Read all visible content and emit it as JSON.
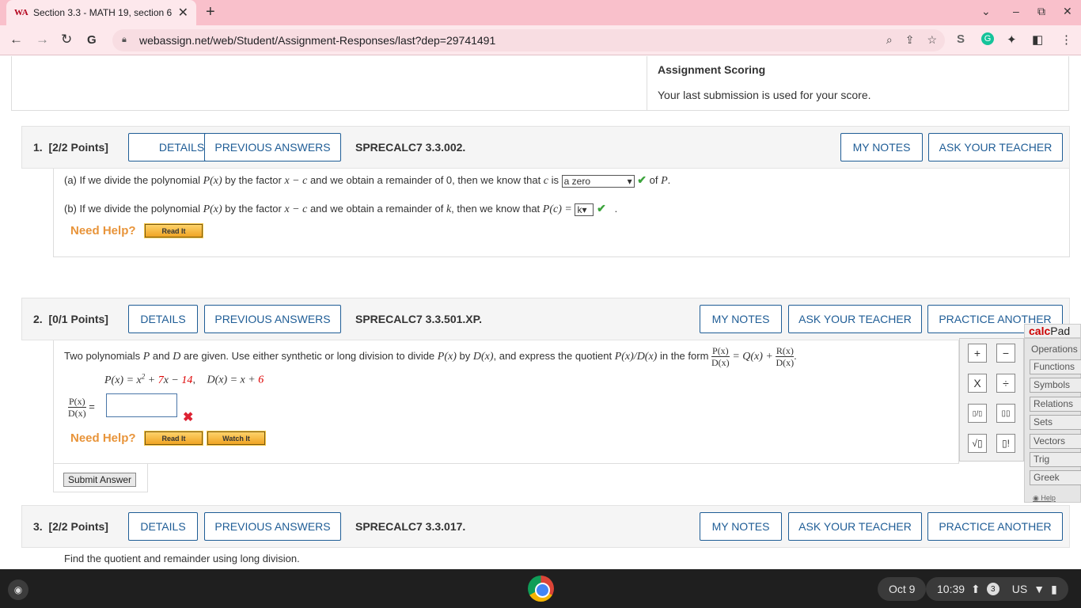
{
  "browser": {
    "tab_title": "Section 3.3 - MATH 19, section 6",
    "favicon": "WA",
    "url": "webassign.net/web/Student/Assignment-Responses/last?dep=29741491"
  },
  "scoring": {
    "title": "Assignment Scoring",
    "text": "Your last submission is used for your score."
  },
  "buttons": {
    "details": "DETAILS",
    "previous_answers": "PREVIOUS ANSWERS",
    "my_notes": "MY NOTES",
    "ask_teacher": "ASK YOUR TEACHER",
    "practice_another": "PRACTICE ANOTHER",
    "read_it": "Read It",
    "watch_it": "Watch It",
    "submit": "Submit Answer",
    "need_help": "Need Help?"
  },
  "q1": {
    "number": "1.",
    "points": "[2/2 Points]",
    "code": "SPRECALC7 3.3.002.",
    "a_prefix": "(a) If we divide the polynomial ",
    "a_mid": " by the factor ",
    "a_mid2": " and we obtain a remainder of 0, then we know that ",
    "a_is": " is ",
    "a_select": "a zero",
    "a_suffix": " of ",
    "b_prefix": "(b) If we divide the polynomial ",
    "b_mid": " by the factor ",
    "b_mid2": " and we obtain a remainder of ",
    "b_then": ", then we know that ",
    "b_select": "k",
    "p": "P",
    "px": "P(x)",
    "xc": "x − c",
    "c": "c",
    "k": "k",
    "pc": "P(c) ="
  },
  "q2": {
    "number": "2.",
    "points": "[0/1 Points]",
    "code": "SPRECALC7 3.3.501.XP.",
    "text1": "Two polynomials ",
    "text2": " and ",
    "text3": " are given. Use either synthetic or long division to divide ",
    "text4": " by ",
    "text5": ", and express the quotient ",
    "text6": " in the form ",
    "P": "P",
    "D": "D",
    "Px": "P(x)",
    "Dx": "D(x)",
    "PxDx": "P(x)/D(x)",
    "Qx": "= Q(x) +",
    "Rx": "R(x)",
    "px_def": "P(x) = x",
    "px_exp": "2",
    "px_plus": " + ",
    "px_7": "7",
    "px_x": "x − ",
    "px_14": "14",
    "dx_def": "D(x) = x + ",
    "dx_6": "6",
    "equals": "="
  },
  "q3": {
    "number": "3.",
    "points": "[2/2 Points]",
    "code": "SPRECALC7 3.3.017.",
    "text": "Find the quotient and remainder using long division."
  },
  "calcpad": {
    "title_a": "calc",
    "title_b": "Pad",
    "operations": "Operations",
    "menu": [
      "Functions",
      "Symbols",
      "Relations",
      "Sets",
      "Vectors",
      "Trig",
      "Greek"
    ],
    "help": "Help",
    "keys": [
      "+",
      "−",
      "X",
      "÷",
      "▯/▯",
      "▯▯",
      "√▯",
      "▯!"
    ]
  },
  "taskbar": {
    "date": "Oct 9",
    "time": "10:39",
    "notif": "3",
    "locale": "US"
  }
}
